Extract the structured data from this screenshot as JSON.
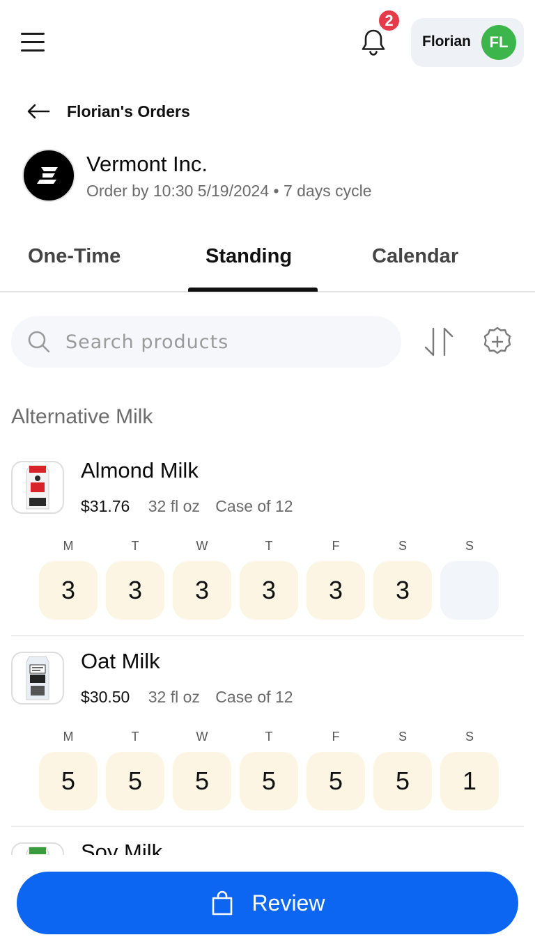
{
  "header": {
    "notification_count": "2",
    "user_name": "Florian",
    "user_initials": "FL"
  },
  "page": {
    "title": "Florian's Orders"
  },
  "vendor": {
    "name": "Vermont Inc.",
    "subtitle": "Order by 10:30 5/19/2024 • 7 days cycle"
  },
  "tabs": [
    {
      "label": "One-Time",
      "active": false
    },
    {
      "label": "Standing",
      "active": true
    },
    {
      "label": "Calendar",
      "active": false
    }
  ],
  "search": {
    "placeholder": "Search products"
  },
  "section": {
    "title": "Alternative Milk"
  },
  "day_labels": [
    "M",
    "T",
    "W",
    "T",
    "F",
    "S",
    "S"
  ],
  "products": [
    {
      "name": "Almond Milk",
      "price": "$31.76",
      "size": "32 fl oz",
      "pack": "Case of 12",
      "quantities": [
        "3",
        "3",
        "3",
        "3",
        "3",
        "3",
        ""
      ]
    },
    {
      "name": "Oat Milk",
      "price": "$30.50",
      "size": "32 fl oz",
      "pack": "Case of 12",
      "quantities": [
        "5",
        "5",
        "5",
        "5",
        "5",
        "5",
        "1"
      ]
    },
    {
      "name": "Soy Milk"
    }
  ],
  "footer": {
    "review_label": "Review",
    "accent_color": "#0c66f2"
  }
}
